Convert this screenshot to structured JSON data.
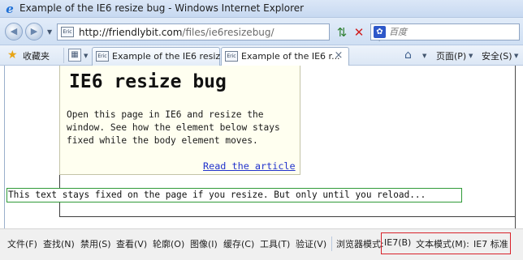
{
  "window": {
    "title": "Example of the IE6 resize bug - Windows Internet Explorer",
    "app_icon": "ie-logo-icon"
  },
  "navigation": {
    "back_icon": "back-arrow-icon",
    "forward_icon": "forward-arrow-icon",
    "address_favicon": "Eric",
    "address_host": "http://friendlybit.com",
    "address_path": "/files/ie6resizebug/",
    "refresh_icon": "refresh-icon",
    "stop_icon": "stop-icon",
    "search_engine_icon": "baidu-paw-icon",
    "search_placeholder": "百度"
  },
  "favorites_bar": {
    "favorites_label": "收藏夹",
    "tabs": [
      {
        "favicon": "Eric",
        "label": "Example of the IE6 resiz...",
        "active": false
      },
      {
        "favicon": "Eric",
        "label": "Example of the IE6 r...",
        "active": true
      }
    ],
    "page_menu": "页面(P)",
    "safety_menu": "安全(S)"
  },
  "page": {
    "heading": "IE6 resize bug",
    "paragraph": "Open this page in IE6 and resize the window. See how the element below stays fixed while the body element moves.",
    "link_text": "Read the article",
    "fixed_text": "This text stays fixed on the page if you resize. But only until you reload..."
  },
  "menu_bar": {
    "items": [
      "文件(F)",
      "查找(N)",
      "禁用(S)",
      "查看(V)",
      "轮廓(O)",
      "图像(I)",
      "缓存(C)",
      "工具(T)",
      "验证(V)"
    ],
    "browser_mode_label": "浏览器模式:",
    "browser_mode_value": "IE7(B)",
    "document_mode_label": "文本模式(M):",
    "document_mode_value": "IE7 标准"
  },
  "colors": {
    "highlight_box": "#d9222a",
    "fixed_box": "#2f9a37",
    "link": "#2233cc",
    "note_background": "#fffff0"
  }
}
